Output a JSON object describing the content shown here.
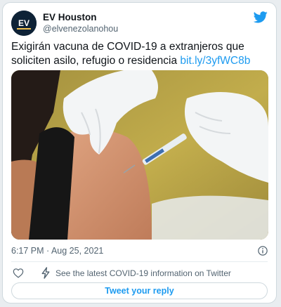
{
  "author": {
    "name": "EV Houston",
    "handle": "@elvenezolanohou",
    "avatar_text": "EV",
    "avatar_icon": "ev-houston-logo"
  },
  "brand": {
    "icon": "twitter-bird-icon",
    "color": "#1d9bf0"
  },
  "tweet": {
    "text": "Exigirán vacuna de COVID-19 a extranjeros que soliciten asilo, refugio o residencia",
    "link": "bit.ly/3yfWC8b"
  },
  "media": {
    "description_icon": "vaccination-photo"
  },
  "meta": {
    "timestamp": "6:17 PM · Aug 25, 2021",
    "info_icon": "info-icon"
  },
  "actions": {
    "like_icon": "heart-icon",
    "covid_icon": "lightning-icon",
    "covid_info_label": "See the latest COVID-19 information on Twitter"
  },
  "reply_button": {
    "label": "Tweet your reply"
  },
  "colors": {
    "accent": "#1d9bf0",
    "text_primary": "#0f1419",
    "text_secondary": "#536471",
    "border": "#cfd9de"
  }
}
